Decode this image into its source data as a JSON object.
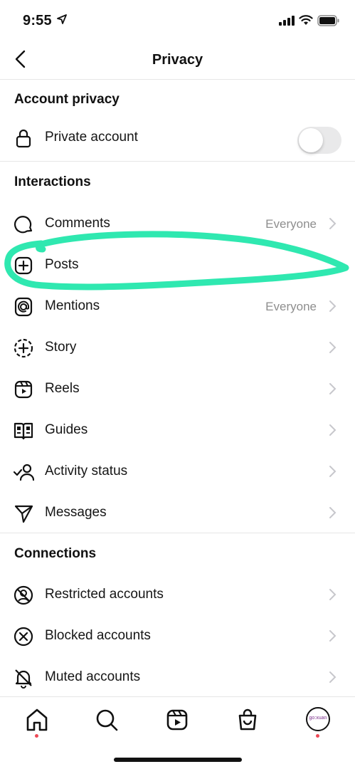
{
  "status": {
    "time": "9:55"
  },
  "header": {
    "title": "Privacy"
  },
  "sections": {
    "account_privacy": {
      "title": "Account privacy",
      "private_account_label": "Private account",
      "private_account_on": false
    },
    "interactions": {
      "title": "Interactions",
      "items": [
        {
          "label": "Comments",
          "value": "Everyone",
          "icon": "comment-icon"
        },
        {
          "label": "Posts",
          "value": "",
          "icon": "add-post-icon"
        },
        {
          "label": "Mentions",
          "value": "Everyone",
          "icon": "mention-icon"
        },
        {
          "label": "Story",
          "value": "",
          "icon": "story-icon"
        },
        {
          "label": "Reels",
          "value": "",
          "icon": "reels-icon"
        },
        {
          "label": "Guides",
          "value": "",
          "icon": "guides-icon"
        },
        {
          "label": "Activity status",
          "value": "",
          "icon": "activity-status-icon"
        },
        {
          "label": "Messages",
          "value": "",
          "icon": "messages-icon"
        }
      ]
    },
    "connections": {
      "title": "Connections",
      "items": [
        {
          "label": "Restricted accounts",
          "icon": "restricted-icon"
        },
        {
          "label": "Blocked accounts",
          "icon": "blocked-icon"
        },
        {
          "label": "Muted accounts",
          "icon": "muted-icon"
        }
      ]
    }
  },
  "tabbar": {
    "items": [
      "home-icon",
      "search-icon",
      "reels-icon",
      "shop-icon",
      "profile-avatar"
    ],
    "avatar_text": "go:xuan"
  },
  "colors": {
    "highlight": "#2fe8b0",
    "notification_dot": "#ed4956",
    "secondary_text": "#8e8e8e"
  }
}
